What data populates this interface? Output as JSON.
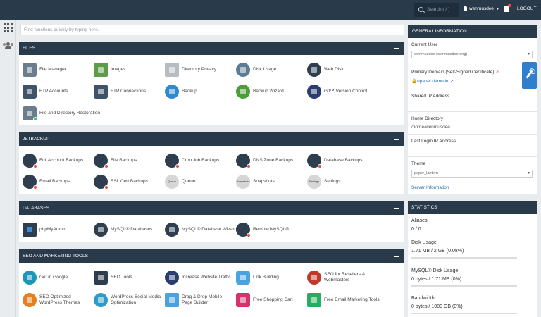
{
  "header": {
    "search_placeholder": "Search ( / )",
    "user": "wenmusdee",
    "logout": "LOGOUT"
  },
  "find_placeholder": "Find functions quickly by typing here.",
  "files": {
    "title": "FILES",
    "items": [
      "File Manager",
      "Images",
      "Directory Privacy",
      "Disk Usage",
      "Web Disk",
      "FTP Accounts",
      "FTP Connections",
      "Backup",
      "Backup Wizard",
      "Git™ Version Control",
      "File and Directory Restoration"
    ]
  },
  "jetbackup": {
    "title": "JETBACKUP",
    "items": [
      "Full Account Backups",
      "File Backups",
      "Cron Job Backups",
      "DNS Zone Backups",
      "Database Backups",
      "Email Backups",
      "SSL Cert Backups",
      "Queue",
      "Snapshots",
      "Settings"
    ],
    "icon_texts": [
      "Queue",
      "Snapshots",
      "Settings"
    ]
  },
  "databases": {
    "title": "DATABASES",
    "items": [
      "phpMyAdmin",
      "MySQL® Databases",
      "MySQL® Database Wizard",
      "Remote MySQL®"
    ]
  },
  "seo": {
    "title": "SEO AND MARKETING TOOLS",
    "items": [
      "Get in Google",
      "SEO Tools",
      "Increase Website Traffic",
      "Link Building",
      "SEO for Resellers & Webmasters",
      "SEO Optimized WordPress Themes",
      "WordPress Social Media Optimization",
      "Drag & Drop Mobile Page Builder",
      "Free Shopping Cart",
      "Free Email Marketing Tools"
    ]
  },
  "general": {
    "title": "GENERAL INFORMATION",
    "current_user_label": "Current User",
    "current_user_value": "wenmusdee (wenmusdee.ong)",
    "primary_domain_label": "Primary Domain (Self-Signed Certificate)",
    "primary_domain_value": "upanel.demo.in",
    "shared_ip_label": "Shared IP Address",
    "home_dir_label": "Home Directory",
    "home_dir_value": "/home/wenmusdee",
    "last_login_label": "Last Login IP Address",
    "theme_label": "Theme",
    "theme_value": "paper_lantern",
    "server_info": "Server Information"
  },
  "stats": {
    "title": "STATISTICS",
    "aliases_label": "Aliases",
    "aliases_value": "0 / 0",
    "disk_label": "Disk Usage",
    "disk_value": "1.71 MB / 2 GB (0.08%)",
    "mysql_label": "MySQL® Disk Usage",
    "mysql_value": "0 bytes / 1.71 MB (0%)",
    "bandwidth_label": "Bandwidth",
    "bandwidth_value": "0 bytes / 1000 GB (0%)"
  }
}
